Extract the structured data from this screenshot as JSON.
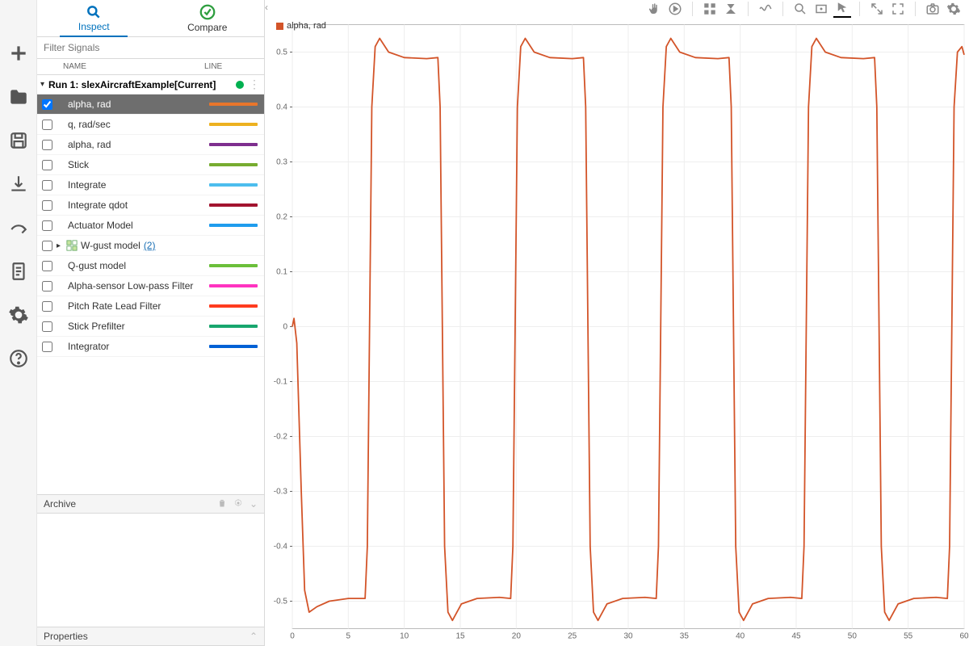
{
  "tabs": {
    "inspect": "Inspect",
    "compare": "Compare"
  },
  "filter_placeholder": "Filter Signals",
  "cols": {
    "name": "NAME",
    "line": "LINE"
  },
  "run_label": "Run 1: slexAircraftExample[Current]",
  "signals": [
    {
      "name": "alpha, rad",
      "color": "#e9762b",
      "checked": true,
      "selected": true
    },
    {
      "name": "q, rad/sec",
      "color": "#edb120"
    },
    {
      "name": "alpha, rad",
      "color": "#7e2f8e"
    },
    {
      "name": "Stick",
      "color": "#77ac30"
    },
    {
      "name": "Integrate",
      "color": "#4dbeee"
    },
    {
      "name": "Integrate qdot",
      "color": "#a2142f"
    },
    {
      "name": "Actuator Model",
      "color": "#1f9ced"
    },
    {
      "name": "W-gust model",
      "group": true,
      "count": 2
    },
    {
      "name": "Q-gust model",
      "color": "#6bbf3a"
    },
    {
      "name": "Alpha-sensor Low-pass Filter",
      "color": "#ff33c0"
    },
    {
      "name": "Pitch Rate Lead Filter",
      "color": "#ff3c1f"
    },
    {
      "name": "Stick Prefilter",
      "color": "#18a66e"
    },
    {
      "name": "Integrator",
      "color": "#0061d5"
    }
  ],
  "archive_label": "Archive",
  "properties_label": "Properties",
  "chart_data": {
    "type": "line",
    "title": "",
    "legend": "alpha, rad",
    "color": "#d35429",
    "xlabel": "",
    "ylabel": "",
    "xlim": [
      0,
      60
    ],
    "ylim": [
      -0.55,
      0.55
    ],
    "xticks": [
      0,
      5,
      10,
      15,
      20,
      25,
      30,
      35,
      40,
      45,
      50,
      55,
      60
    ],
    "yticks": [
      -0.5,
      -0.4,
      -0.3,
      -0.2,
      -0.1,
      0,
      0.1,
      0.2,
      0.3,
      0.4,
      0.5
    ],
    "series": [
      {
        "name": "alpha, rad",
        "x": [
          0,
          0.15,
          0.4,
          0.8,
          1.1,
          1.5,
          2.2,
          3.3,
          5.0,
          6.5,
          6.7,
          6.9,
          7.1,
          7.4,
          7.8,
          8.6,
          10.0,
          12.0,
          13.0,
          13.2,
          13.4,
          13.6,
          13.9,
          14.3,
          15.1,
          16.5,
          18.5,
          19.5,
          19.7,
          19.9,
          20.1,
          20.4,
          20.8,
          21.6,
          23.0,
          25.0,
          26.0,
          26.2,
          26.4,
          26.6,
          26.9,
          27.3,
          28.1,
          29.5,
          31.5,
          32.5,
          32.7,
          32.9,
          33.1,
          33.4,
          33.8,
          34.6,
          36.0,
          38.0,
          39.0,
          39.2,
          39.4,
          39.6,
          39.9,
          40.3,
          41.1,
          42.5,
          44.5,
          45.5,
          45.7,
          45.9,
          46.1,
          46.4,
          46.8,
          47.6,
          49.0,
          51.0,
          52.0,
          52.2,
          52.4,
          52.6,
          52.9,
          53.3,
          54.1,
          55.5,
          57.5,
          58.5,
          58.7,
          58.9,
          59.1,
          59.4,
          59.8,
          60.0
        ],
        "y": [
          0.0,
          0.015,
          -0.03,
          -0.3,
          -0.48,
          -0.52,
          -0.51,
          -0.5,
          -0.495,
          -0.495,
          -0.4,
          0.0,
          0.4,
          0.51,
          0.525,
          0.5,
          0.49,
          0.488,
          0.49,
          0.4,
          0.0,
          -0.4,
          -0.52,
          -0.535,
          -0.505,
          -0.495,
          -0.493,
          -0.495,
          -0.4,
          0.0,
          0.4,
          0.51,
          0.525,
          0.5,
          0.49,
          0.488,
          0.49,
          0.4,
          0.0,
          -0.4,
          -0.52,
          -0.535,
          -0.505,
          -0.495,
          -0.493,
          -0.495,
          -0.4,
          0.0,
          0.4,
          0.51,
          0.525,
          0.5,
          0.49,
          0.488,
          0.49,
          0.4,
          0.0,
          -0.4,
          -0.52,
          -0.535,
          -0.505,
          -0.495,
          -0.493,
          -0.495,
          -0.4,
          0.0,
          0.4,
          0.51,
          0.525,
          0.5,
          0.49,
          0.488,
          0.49,
          0.4,
          0.0,
          -0.4,
          -0.52,
          -0.535,
          -0.505,
          -0.495,
          -0.493,
          -0.495,
          -0.4,
          0.0,
          0.4,
          0.5,
          0.51,
          0.495
        ]
      }
    ]
  }
}
